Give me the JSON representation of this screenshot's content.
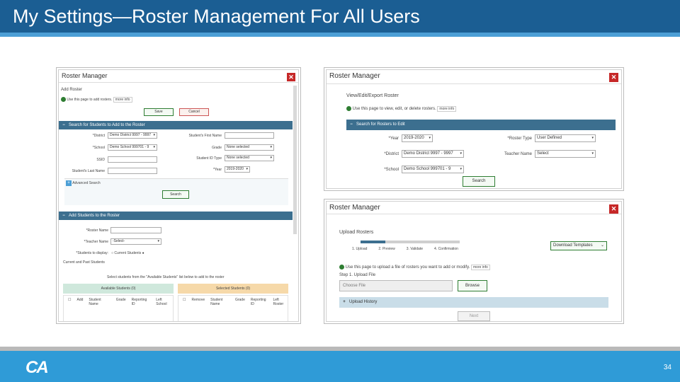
{
  "slide": {
    "title": "My Settings—Roster Management For All Users",
    "page_number": "34",
    "logo_text": "CA"
  },
  "add_roster_window": {
    "window_title": "Roster Manager",
    "heading": "Add Roster",
    "info_text": "Use this page to add rosters.",
    "more_info": "more info",
    "save_label": "Save",
    "cancel_label": "Cancel",
    "search_section_title": "Search for Students to Add to the Roster",
    "district_label": "*District",
    "district_value": "Demo District 9997 - 9997",
    "school_label": "*School",
    "school_value": "Demo School 999701 - 9",
    "ssid_label": "SSID",
    "last_name_label": "Student's Last Name",
    "first_name_label": "Student's First Name",
    "grade_label": "Grade",
    "grade_value": "None selected",
    "student_id_type_label": "Student ID Type",
    "student_id_type_value": "None selected",
    "year_label": "*Year",
    "year_value": "2019-2020",
    "advanced_search": "Advanced Search",
    "search_label": "Search",
    "add_section_title": "Add Students to the Roster",
    "roster_name_label": "*Roster Name",
    "teacher_name_label": "*Teacher Name",
    "teacher_name_value": "-Select-",
    "students_display_label": "*Students to display:",
    "current_students": "Current Students",
    "current_past": "Current and Past Students",
    "select_instruction": "Select students from the \"Available Students\" list below to add to the roster",
    "available_header": "Available Students (0)",
    "selected_header": "Selected Students (0)",
    "available_cols": [
      "Add",
      "Student Name",
      "Grade",
      "Reporting ID",
      "Left School"
    ],
    "selected_cols": [
      "Remove",
      "Student Name",
      "Grade",
      "Reporting ID",
      "Left Roster"
    ]
  },
  "view_roster_window": {
    "window_title": "Roster Manager",
    "heading": "View/Edit/Export Roster",
    "info_text": "Use this page to view, edit, or delete rosters.",
    "more_info": "more info",
    "search_section_title": "Search for Rosters to Edit",
    "year_label": "*Year",
    "year_value": "2019-2020",
    "district_label": "*District",
    "district_value": "Demo District 9997 - 9997",
    "school_label": "*School",
    "school_value": "Demo School 999701 - 9",
    "roster_type_label": "*Roster Type",
    "roster_type_value": "User Defined",
    "teacher_name_label": "Teacher Name",
    "teacher_name_value": "Select",
    "search_label": "Search"
  },
  "upload_roster_window": {
    "window_title": "Roster Manager",
    "heading": "Upload Rosters",
    "steps": [
      "1. Upload",
      "2. Preview",
      "3. Validate",
      "4. Confirmation"
    ],
    "download_templates": "Download Templates",
    "info_text": "Use this page to upload a file of rosters you want to add or modify.",
    "more_info": "more info",
    "step_title": "Step 1. Upload File",
    "choose_file": "Choose File",
    "browse_label": "Browse",
    "upload_history": "Upload History",
    "next_label": "Next"
  },
  "colors": {
    "header": "#1b5e93",
    "footer": "#2f9bd7",
    "section_bar": "#3c6f8f",
    "close_button": "#c62828",
    "info_green": "#2e7d32"
  }
}
